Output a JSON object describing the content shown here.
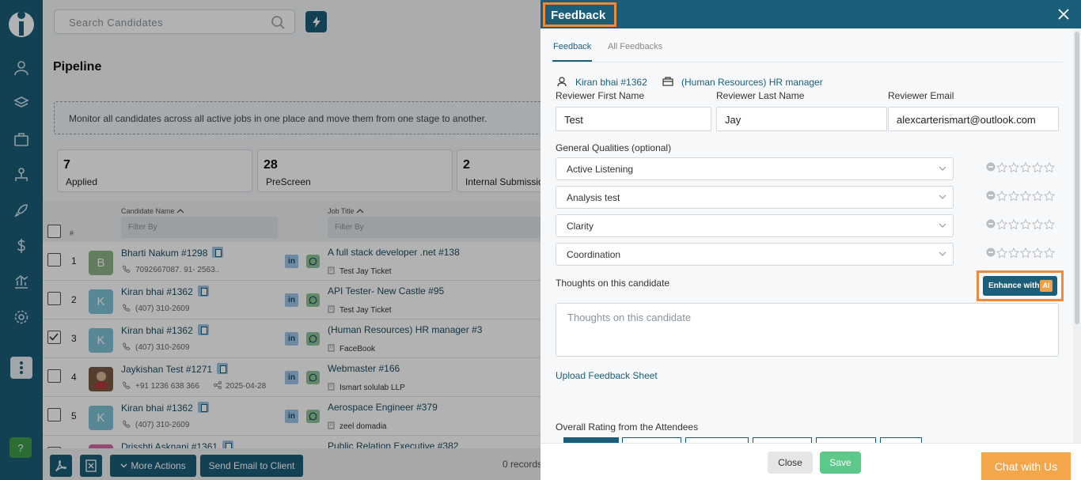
{
  "search": {
    "placeholder": "Search Candidates"
  },
  "page": {
    "title": "Pipeline",
    "info": "Monitor all candidates across all active jobs in one place and move them from one stage to another."
  },
  "stats": [
    {
      "num": "7",
      "label": "Applied"
    },
    {
      "num": "28",
      "label": "PreScreen"
    },
    {
      "num": "2",
      "label": "Internal Submission"
    }
  ],
  "table": {
    "num_header": "#",
    "candidate_header": "Candidate Name",
    "job_header": "Job Title",
    "filter_placeholder": "Filter By",
    "rows": [
      {
        "idx": "1",
        "initial": "B",
        "name": "Bharti Nakum #1298",
        "phone": "7092667087. 91- 2563..",
        "extra": "",
        "job": "A full stack developer .net #138",
        "client": "Test Jay Ticket",
        "checked": false,
        "avatar_color": "#8fb089"
      },
      {
        "idx": "2",
        "initial": "K",
        "name": "Kiran bhai #1362",
        "phone": "(407) 310-2609",
        "extra": "",
        "job": "API Tester- New Castle #95",
        "client": "Test Jay Ticket",
        "checked": false,
        "avatar_color": "#7ec3d6"
      },
      {
        "idx": "3",
        "initial": "K",
        "name": "Kiran bhai #1362",
        "phone": "(407) 310-2609",
        "extra": "",
        "job": "(Human Resources) HR manager #3",
        "client": "FaceBook",
        "checked": true,
        "avatar_color": "#7ec3d6"
      },
      {
        "idx": "4",
        "initial": "",
        "name": "Jaykishan Test #1271",
        "phone": "+91 1236 638 366",
        "extra": "2025-04-28",
        "job": "Webmaster #166",
        "client": "Ismart solulab LLP",
        "checked": false,
        "avatar_color": "#7a5a45"
      },
      {
        "idx": "5",
        "initial": "K",
        "name": "Kiran bhai #1362",
        "phone": "(407) 310-2609",
        "extra": "",
        "job": "Aerospace Engineer #379",
        "client": "zeel domadia",
        "checked": false,
        "avatar_color": "#7ec3d6"
      },
      {
        "idx": "",
        "initial": "",
        "name": "Drisshti Asknani #1361",
        "phone": "",
        "extra": "",
        "job": "Public Relation Executive #382",
        "client": "",
        "checked": false,
        "avatar_color": "#d66ba6"
      }
    ]
  },
  "bottom": {
    "more_actions": "More Actions",
    "send_email": "Send Email to Client",
    "records": "0 records"
  },
  "feedback": {
    "title": "Feedback",
    "tabs": [
      "Feedback",
      "All Feedbacks"
    ],
    "candidate": "Kiran bhai #1362",
    "job": "(Human Resources) HR manager",
    "first_name_label": "Reviewer First Name",
    "last_name_label": "Reviewer Last Name",
    "email_label": "Reviewer Email",
    "first_name": "Test",
    "last_name": "Jay",
    "email": "alexcarterismart@outlook.com",
    "qualities_label": "General Qualities (optional)",
    "qualities": [
      "Active Listening",
      "Analysis test",
      "Clarity",
      "Coordination"
    ],
    "thoughts_label": "Thoughts on this candidate",
    "thoughts_placeholder": "Thoughts on this candidate",
    "enhance_label": "Enhance with",
    "ai_badge": "AI",
    "upload": "Upload Feedback Sheet",
    "overall": "Overall Rating from the Attendees",
    "close": "Close",
    "save": "Save"
  },
  "chat": {
    "label": "Chat with Us"
  },
  "help": {
    "label": "?"
  },
  "colors": {
    "brand": "#1b5e79",
    "highlight": "#f08a3c",
    "save": "#5cc98b",
    "chat": "#f4a64b"
  }
}
